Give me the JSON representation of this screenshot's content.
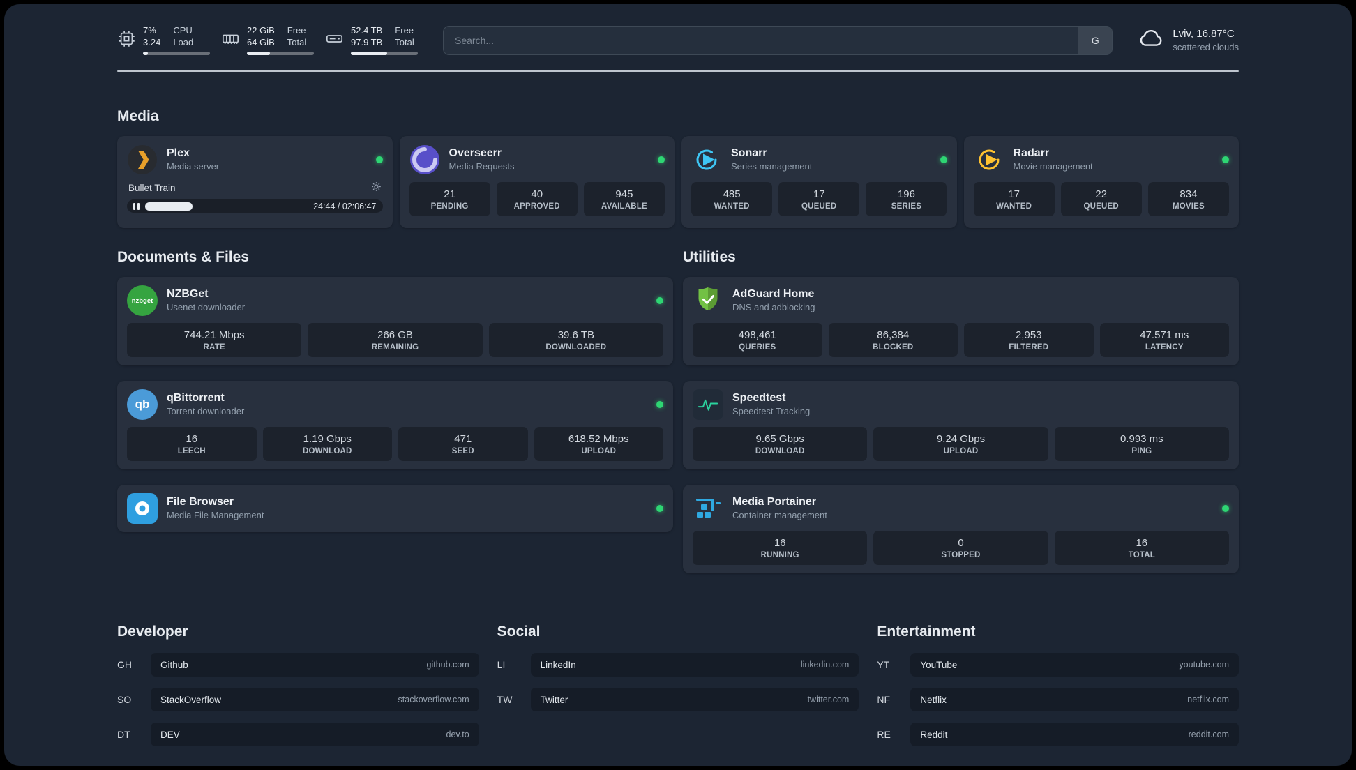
{
  "colors": {
    "page_background": "#1c2533",
    "status_online": "#2ed573",
    "plex_accent": "#e8a02a",
    "overseerr_accent": "#584fc9",
    "sonarr_accent": "#3ec6f4",
    "radarr_accent": "#ffc230",
    "nzbget_accent": "#35a440",
    "qbittorrent_accent": "#4b9bd8",
    "filebrowser_accent": "#2f9fe0",
    "adguard_accent": "#72c144",
    "speedtest_accent": "#2bd39e",
    "portainer_accent": "#2fa9e1"
  },
  "topbar": {
    "resources": [
      {
        "name": "cpu",
        "value_top": "7%",
        "value_bottom": "3.24",
        "label_top": "CPU",
        "label_bottom": "Load",
        "bar_pct": 7
      },
      {
        "name": "memory",
        "value_top": "22 GiB",
        "value_bottom": "64 GiB",
        "label_top": "Free",
        "label_bottom": "Total",
        "bar_pct": 34
      },
      {
        "name": "disk",
        "value_top": "52.4 TB",
        "value_bottom": "97.9 TB",
        "label_top": "Free",
        "label_bottom": "Total",
        "bar_pct": 54
      }
    ],
    "search": {
      "placeholder": "Search...",
      "provider_button": "G"
    },
    "weather": {
      "location": "Lviv, 16.87°C",
      "condition": "scattered clouds"
    }
  },
  "media": {
    "heading": "Media",
    "plex": {
      "title": "Plex",
      "subtitle": "Media server",
      "online": true,
      "now_playing": "Bullet Train",
      "time": "24:44 / 02:06:47",
      "progress_pct": 19.5
    },
    "overseerr": {
      "title": "Overseerr",
      "subtitle": "Media Requests",
      "online": true,
      "stats": [
        {
          "value": "21",
          "label": "PENDING"
        },
        {
          "value": "40",
          "label": "APPROVED"
        },
        {
          "value": "945",
          "label": "AVAILABLE"
        }
      ]
    },
    "sonarr": {
      "title": "Sonarr",
      "subtitle": "Series management",
      "online": true,
      "stats": [
        {
          "value": "485",
          "label": "WANTED"
        },
        {
          "value": "17",
          "label": "QUEUED"
        },
        {
          "value": "196",
          "label": "SERIES"
        }
      ]
    },
    "radarr": {
      "title": "Radarr",
      "subtitle": "Movie management",
      "online": true,
      "stats": [
        {
          "value": "17",
          "label": "WANTED"
        },
        {
          "value": "22",
          "label": "QUEUED"
        },
        {
          "value": "834",
          "label": "MOVIES"
        }
      ]
    }
  },
  "documents": {
    "heading": "Documents & Files",
    "nzbget": {
      "title": "NZBGet",
      "subtitle": "Usenet downloader",
      "icon_label": "nzbget",
      "online": true,
      "stats": [
        {
          "value": "744.21 Mbps",
          "label": "RATE"
        },
        {
          "value": "266 GB",
          "label": "REMAINING"
        },
        {
          "value": "39.6 TB",
          "label": "DOWNLOADED"
        }
      ]
    },
    "qbittorrent": {
      "title": "qBittorrent",
      "subtitle": "Torrent downloader",
      "icon_label": "qb",
      "online": true,
      "stats": [
        {
          "value": "16",
          "label": "LEECH"
        },
        {
          "value": "1.19 Gbps",
          "label": "DOWNLOAD"
        },
        {
          "value": "471",
          "label": "SEED"
        },
        {
          "value": "618.52 Mbps",
          "label": "UPLOAD"
        }
      ]
    },
    "filebrowser": {
      "title": "File Browser",
      "subtitle": "Media File Management",
      "online": true
    }
  },
  "utilities": {
    "heading": "Utilities",
    "adguard": {
      "title": "AdGuard Home",
      "subtitle": "DNS and adblocking",
      "online": false,
      "stats": [
        {
          "value": "498,461",
          "label": "QUERIES"
        },
        {
          "value": "86,384",
          "label": "BLOCKED"
        },
        {
          "value": "2,953",
          "label": "FILTERED"
        },
        {
          "value": "47.571 ms",
          "label": "LATENCY"
        }
      ]
    },
    "speedtest": {
      "title": "Speedtest",
      "subtitle": "Speedtest Tracking",
      "online": false,
      "stats": [
        {
          "value": "9.65 Gbps",
          "label": "DOWNLOAD"
        },
        {
          "value": "9.24 Gbps",
          "label": "UPLOAD"
        },
        {
          "value": "0.993 ms",
          "label": "PING"
        }
      ]
    },
    "portainer": {
      "title": "Media Portainer",
      "subtitle": "Container management",
      "online": true,
      "stats": [
        {
          "value": "16",
          "label": "RUNNING"
        },
        {
          "value": "0",
          "label": "STOPPED"
        },
        {
          "value": "16",
          "label": "TOTAL"
        }
      ]
    }
  },
  "bookmarks": {
    "groups": [
      {
        "heading": "Developer",
        "links": [
          {
            "abbr": "GH",
            "name": "Github",
            "url": "github.com"
          },
          {
            "abbr": "SO",
            "name": "StackOverflow",
            "url": "stackoverflow.com"
          },
          {
            "abbr": "DT",
            "name": "DEV",
            "url": "dev.to"
          }
        ]
      },
      {
        "heading": "Social",
        "links": [
          {
            "abbr": "LI",
            "name": "LinkedIn",
            "url": "linkedin.com"
          },
          {
            "abbr": "TW",
            "name": "Twitter",
            "url": "twitter.com"
          }
        ]
      },
      {
        "heading": "Entertainment",
        "links": [
          {
            "abbr": "YT",
            "name": "YouTube",
            "url": "youtube.com"
          },
          {
            "abbr": "NF",
            "name": "Netflix",
            "url": "netflix.com"
          },
          {
            "abbr": "RE",
            "name": "Reddit",
            "url": "reddit.com"
          }
        ]
      }
    ]
  }
}
